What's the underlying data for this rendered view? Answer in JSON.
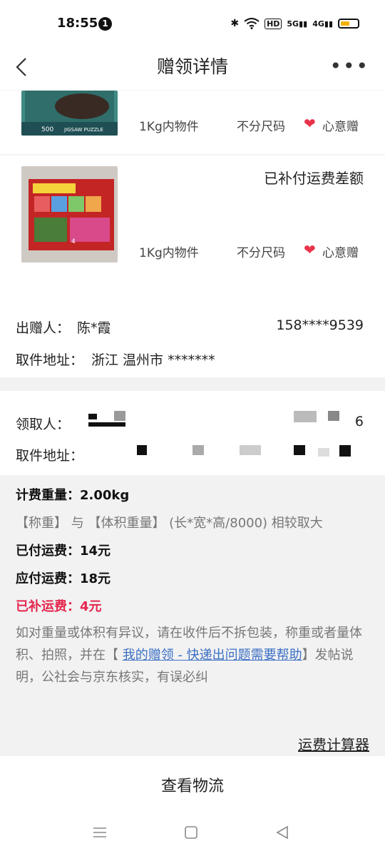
{
  "status": {
    "time": "18:55",
    "notif_count": "1",
    "hd": "HD",
    "net1": "5G",
    "net2": "4G",
    "battery_level": 0.55,
    "battery_color": "#f2b200"
  },
  "nav": {
    "title": "赠领详情"
  },
  "items": [
    {
      "weight": "1Kg内物件",
      "size": "不分尺码",
      "tag": "心意赠",
      "status": ""
    },
    {
      "weight": "1Kg内物件",
      "size": "不分尺码",
      "tag": "心意赠",
      "status": "已补付运费差额"
    }
  ],
  "giver": {
    "name_label": "出赠人：",
    "name": "陈*霞",
    "phone": "158****9539",
    "addr_label": "取件地址：",
    "addr": "浙江 温州市 *******"
  },
  "receiver": {
    "name_label": "领取人：",
    "phone_tail": "6",
    "addr_label": "取件地址："
  },
  "fee": {
    "billed_label": "计费重量：",
    "billed_value": "2.00kg",
    "rule": "【称重】 与 【体积重量】 (长*宽*高/8000) 相较取大",
    "paid_label": "已付运费：",
    "paid_value": "14元",
    "due_label": "应付运费：",
    "due_value": "18元",
    "extra_label": "已补运费：",
    "extra_value": "4元",
    "note_pre": "如对重量或体积有异议，请在收件后不拆包装，称重或者量体积、拍照，并在【 ",
    "note_link": "我的赠领 - 快递出问题需要帮助",
    "note_post": "】发帖说明，公社会与京东核实，有误必纠",
    "calc_label": "运费计算器"
  },
  "bottom": {
    "logistics_label": "查看物流"
  },
  "colors": {
    "accent_red": "#e5264e",
    "heart": "#e8334a",
    "link": "#3b6fc4"
  }
}
